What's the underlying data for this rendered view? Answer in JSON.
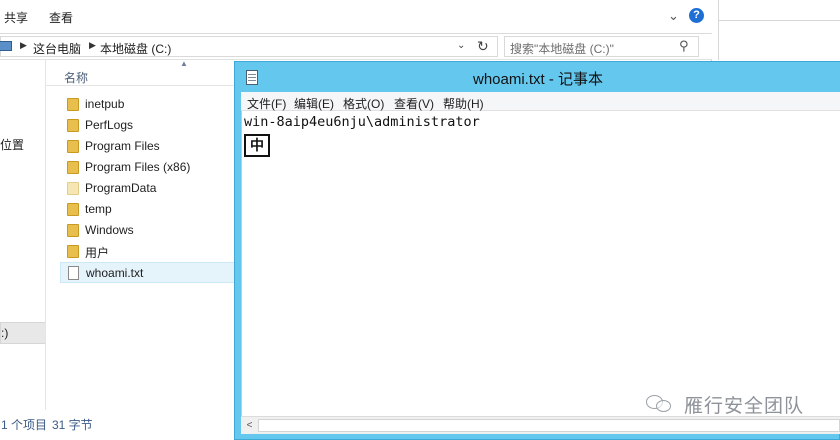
{
  "explorer": {
    "ribbon_tabs": [
      "共享",
      "查看"
    ],
    "breadcrumb": [
      "这台电脑",
      "本地磁盘 (C:)"
    ],
    "search_placeholder": "搜索\"本地磁盘 (C:)\"",
    "column_header": "名称",
    "nav_location": "位置",
    "nav_drive": ":)",
    "files": [
      {
        "name": "inetpub",
        "type": "folder"
      },
      {
        "name": "PerfLogs",
        "type": "folder"
      },
      {
        "name": "Program Files",
        "type": "folder"
      },
      {
        "name": "Program Files (x86)",
        "type": "folder"
      },
      {
        "name": "ProgramData",
        "type": "hidden-folder"
      },
      {
        "name": "temp",
        "type": "folder"
      },
      {
        "name": "Windows",
        "type": "folder"
      },
      {
        "name": "用户",
        "type": "folder"
      },
      {
        "name": "whoami.txt",
        "type": "file",
        "selected": true
      }
    ],
    "status_items": "1 个项目",
    "status_size": "31 字节"
  },
  "notepad": {
    "title": "whoami.txt - 记事本",
    "menus": [
      "文件(F)",
      "编辑(E)",
      "格式(O)",
      "查看(V)",
      "帮助(H)"
    ],
    "content": "win-8aip4eu6nju\\administrator",
    "ime_indicator": "中"
  },
  "watermark": {
    "text": "雁行安全团队"
  },
  "colors": {
    "notepad_frame": "#64c8ee",
    "help_icon": "#1d6fd6",
    "status_text": "#3a5a86"
  }
}
